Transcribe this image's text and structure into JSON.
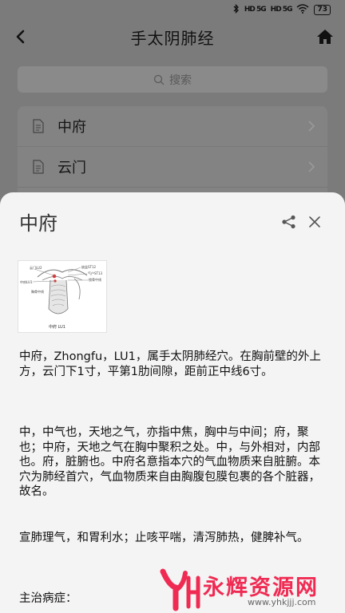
{
  "status_bar": {
    "signal1": "HD 5G",
    "signal2": "HD 5G",
    "battery": "73"
  },
  "header": {
    "title": "手太阴肺经"
  },
  "search": {
    "placeholder": "搜索"
  },
  "list": {
    "items": [
      {
        "label": "中府"
      },
      {
        "label": "云门"
      }
    ]
  },
  "detail": {
    "title": "中府",
    "figure": {
      "label": "中府  LU1",
      "annotations": [
        "云门LU2",
        "中府LU1",
        "缺盆ST12",
        "气户ST13",
        "锁骨中线",
        "胸骨中线"
      ]
    },
    "paragraphs": [
      "中府，Zhongfu，LU1，属手太阴肺经穴。在胸前壁的外上方，云门下1寸，平第1肋间隙，距前正中线6寸。",
      "中，中气也，天地之气，亦指中焦，胸中与中间；府，聚也；中府，天地之气在胸中聚积之处。中，与外相对，内部也。府，脏腑也。中府名意指本穴的气血物质来自脏腑。本穴为肺经首穴，气血物质来自由胸腹包膜包裹的各个脏器，故名。",
      "宣肺理气，和胃利水；止咳平喘，清泻肺热，健脾补气。",
      "主治病症："
    ]
  },
  "watermark": {
    "text": "永辉资源网",
    "url": "www.yhkjjj.com"
  },
  "colors": {
    "accent_watermark": "#f02b53",
    "sheet_bg": "#f4f4f4",
    "dim_bg": "#7b7b7b"
  }
}
